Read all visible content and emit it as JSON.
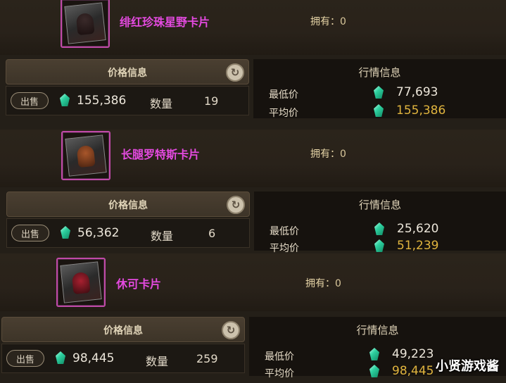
{
  "sections": [
    {
      "card_name": "绯红珍珠星野卡片",
      "owned_label": "拥有：",
      "owned_value": "0",
      "price_title": "价格信息",
      "sell_label": "出售",
      "price": "155,386",
      "quantity_label": "数量",
      "quantity": "19",
      "market_title": "行情信息",
      "min_label": "最低价",
      "min_price": "77,693",
      "avg_label": "平均价",
      "avg_price": "155,386"
    },
    {
      "card_name": "长腿罗特斯卡片",
      "owned_label": "拥有：",
      "owned_value": "0",
      "price_title": "价格信息",
      "sell_label": "出售",
      "price": "56,362",
      "quantity_label": "数量",
      "quantity": "6",
      "market_title": "行情信息",
      "min_label": "最低价",
      "min_price": "25,620",
      "avg_label": "平均价",
      "avg_price": "51,239"
    },
    {
      "card_name": "休可卡片",
      "owned_label": "拥有：",
      "owned_value": "0",
      "price_title": "价格信息",
      "sell_label": "出售",
      "price": "98,445",
      "quantity_label": "数量",
      "quantity": "259",
      "market_title": "行情信息",
      "min_label": "最低价",
      "min_price": "49,223",
      "avg_label": "平均价",
      "avg_price": "98,445"
    }
  ],
  "watermark": "小贤游戏酱",
  "icons": {
    "currency": "gem-icon",
    "refresh": "refresh-icon"
  },
  "colors": {
    "card_name": "#e44ae0",
    "avg_price": "#e0b43e",
    "frame": "#c04aa8"
  }
}
